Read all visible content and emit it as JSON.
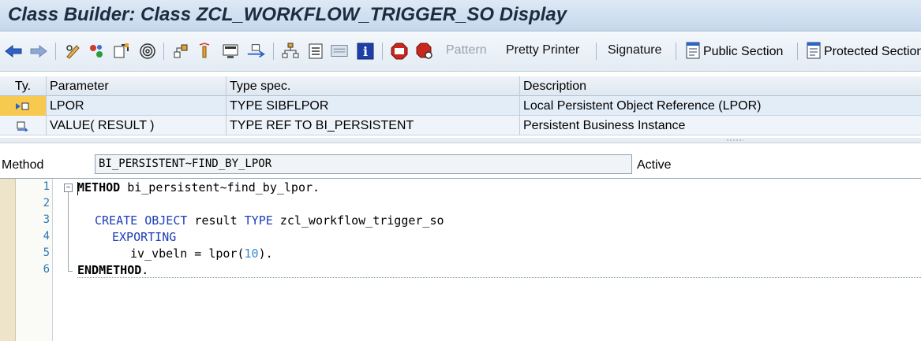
{
  "window": {
    "title": "Class Builder: Class ZCL_WORKFLOW_TRIGGER_SO Display"
  },
  "toolbar": {
    "icons": [
      "back-arrow-icon",
      "forward-arrow-icon",
      "pencil-glasses-icon",
      "activate-icon",
      "check-icon",
      "spiral-icon",
      "hierarchy-icon",
      "lamp-icon",
      "display-object-icon",
      "navigate-icon",
      "org-tree-icon",
      "list-icon",
      "panel-icon",
      "info-icon",
      "stop-sign-icon",
      "stop-sign-search-icon",
      "public-section-icon",
      "protected-section-icon"
    ],
    "pattern_label": "Pattern",
    "pretty_printer_label": "Pretty Printer",
    "signature_label": "Signature",
    "public_section_label": "Public Section",
    "protected_section_label": "Protected Section"
  },
  "params": {
    "headers": [
      "Ty.",
      "Parameter",
      "Type spec.",
      "Description"
    ],
    "rows": [
      {
        "ty_icon": "importing-param-icon",
        "parameter": "LPOR",
        "type_spec": "TYPE SIBFLPOR",
        "description": "Local Persistent Object Reference (LPOR)"
      },
      {
        "ty_icon": "returning-param-icon",
        "parameter": "VALUE( RESULT )",
        "type_spec": "TYPE REF TO BI_PERSISTENT",
        "description": "Persistent Business Instance"
      }
    ]
  },
  "method": {
    "label": "Method",
    "value": "BI_PERSISTENT~FIND_BY_LPOR",
    "status": "Active"
  },
  "editor": {
    "line_numbers": [
      "1",
      "2",
      "3",
      "4",
      "5",
      "6"
    ],
    "lines": {
      "l1_kw": "METHOD",
      "l1_rest": " bi_persistent~find_by_lpor.",
      "l3_kw1": "CREATE",
      "l3_kw2": "OBJECT",
      "l3_mid": " result ",
      "l3_kw3": "TYPE",
      "l3_rest": " zcl_workflow_trigger_so",
      "l4_kw": "EXPORTING",
      "l5_a": "iv_vbeln = lpor(",
      "l5_num": "10",
      "l5_b": ").",
      "l6_kw": "ENDMETHOD",
      "l6_rest": "."
    }
  },
  "colors": {
    "keyword": "#1d3db7",
    "number": "#3a8ad3",
    "selected_cell": "#f7c94f"
  }
}
